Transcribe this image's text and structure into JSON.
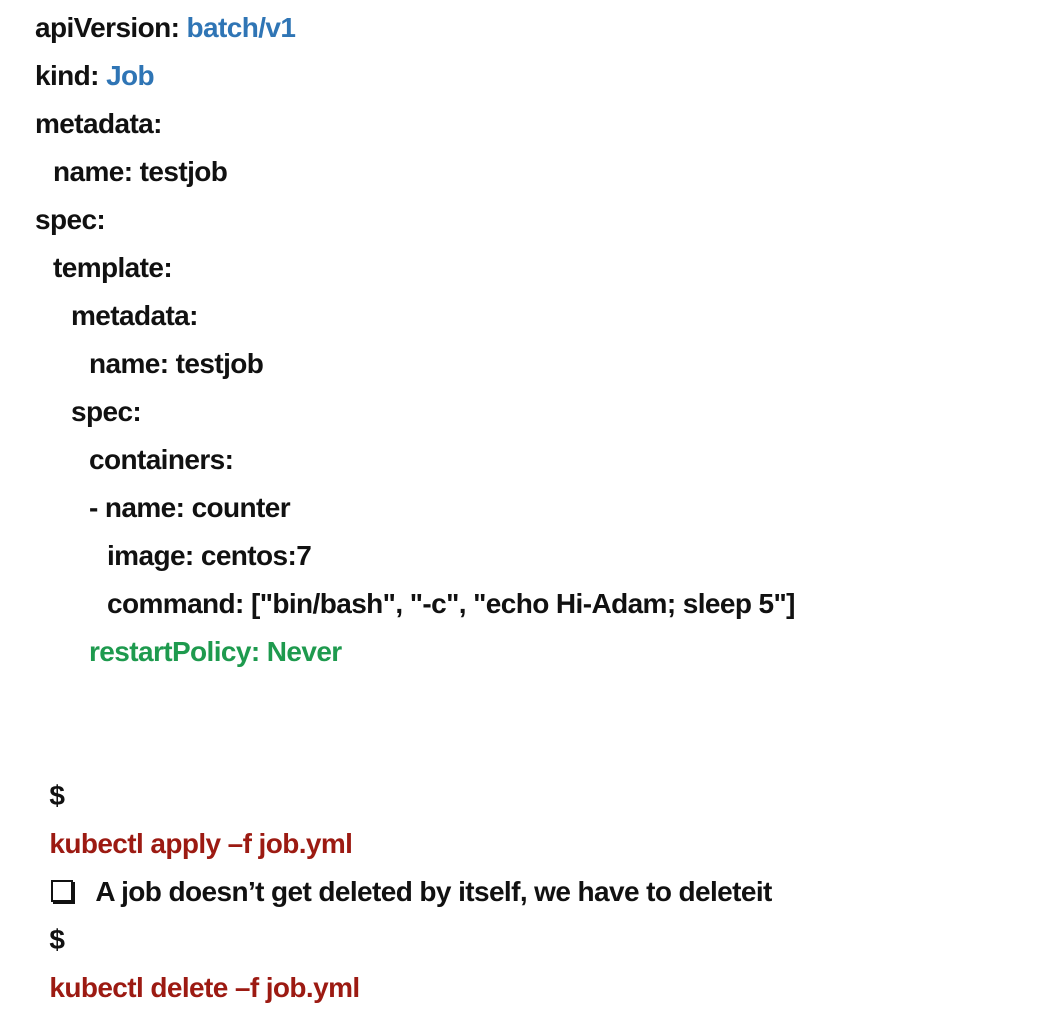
{
  "yaml": [
    {
      "key": "apiVersion:",
      "value": "batch/v1",
      "indent": 0,
      "value_color": "#2f75b5"
    },
    {
      "key": "kind:",
      "value": "Job",
      "indent": 0,
      "value_color": "#2f75b5"
    },
    {
      "key": "metadata:",
      "value": "",
      "indent": 0
    },
    {
      "key": "name:",
      "value": "testjob",
      "indent": 1
    },
    {
      "key": "spec:",
      "value": "",
      "indent": 0
    },
    {
      "key": "template:",
      "value": "",
      "indent": 1
    },
    {
      "key": "metadata:",
      "value": "",
      "indent": 2
    },
    {
      "key": "name:",
      "value": "testjob",
      "indent": 3
    },
    {
      "key": "spec:",
      "value": "",
      "indent": 2
    },
    {
      "key": "containers:",
      "value": "",
      "indent": 3
    },
    {
      "key": "- name:",
      "value": "counter",
      "indent": 3
    },
    {
      "key": "image:",
      "value": "centos:7",
      "indent": 4
    },
    {
      "key": "command:",
      "value": "[\"bin/bash\", \"-c\", \"echo Hi-Adam; sleep 5\"]",
      "indent": 4
    },
    {
      "key": "restartPolicy:",
      "value": "Never",
      "indent": 3,
      "color": "#1e9a4e"
    }
  ],
  "commands": {
    "apply": {
      "prompt": "$",
      "text": "kubectl apply –f job.yml"
    },
    "note": "A job doesn’t get deleted by itself, we have to deleteit",
    "delete": {
      "prompt": "$",
      "text": "kubectl delete –f job.yml"
    }
  },
  "colors": {
    "accent_blue": "#2f75b5",
    "green": "#1e9a4e",
    "command_red": "#9c1a12"
  }
}
